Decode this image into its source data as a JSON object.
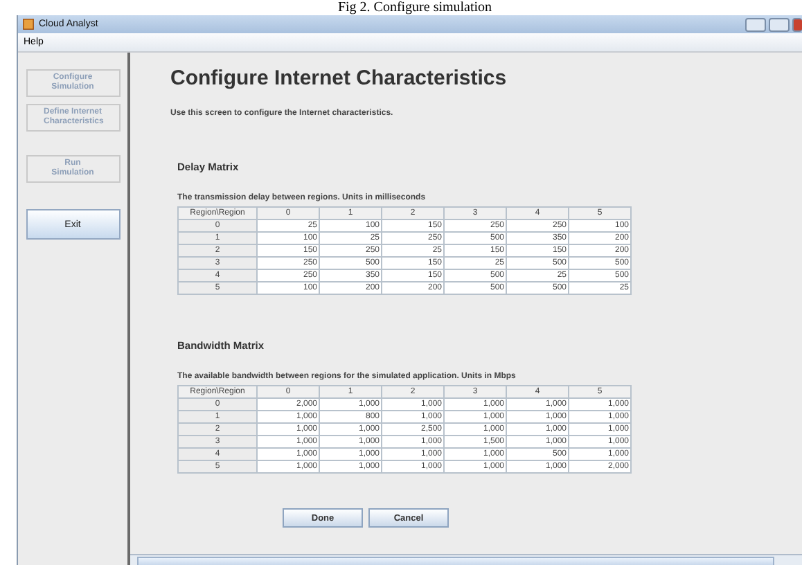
{
  "caption": "Fig 2. Configure simulation",
  "window": {
    "title": "Cloud Analyst"
  },
  "menu": [
    "Help"
  ],
  "sidebar": [
    {
      "label": "Configure Simulation",
      "disabled": true
    },
    {
      "label": "Define Internet Characteristics",
      "disabled": true
    },
    {
      "label": "Run Simulation",
      "disabled": true
    },
    {
      "label": "Exit",
      "disabled": false
    }
  ],
  "heading": "Configure Internet Characteristics",
  "description": "Use this screen to configure the Internet characteristics.",
  "matrices": [
    {
      "title": "Delay Matrix",
      "subtitle": "The transmission delay between regions. Units in milliseconds",
      "columns": [
        "Region\\Region",
        "0",
        "1",
        "2",
        "3",
        "4",
        "5"
      ],
      "rows": [
        [
          "0",
          "25",
          "100",
          "150",
          "250",
          "250",
          "100"
        ],
        [
          "1",
          "100",
          "25",
          "250",
          "500",
          "350",
          "200"
        ],
        [
          "2",
          "150",
          "250",
          "25",
          "150",
          "150",
          "200"
        ],
        [
          "3",
          "250",
          "500",
          "150",
          "25",
          "500",
          "500"
        ],
        [
          "4",
          "250",
          "350",
          "150",
          "500",
          "25",
          "500"
        ],
        [
          "5",
          "100",
          "200",
          "200",
          "500",
          "500",
          "25"
        ]
      ]
    },
    {
      "title": "Bandwidth Matrix",
      "subtitle": "The available bandwidth between regions for the simulated application. Units in Mbps",
      "columns": [
        "Region\\Region",
        "0",
        "1",
        "2",
        "3",
        "4",
        "5"
      ],
      "rows": [
        [
          "0",
          "2,000",
          "1,000",
          "1,000",
          "1,000",
          "1,000",
          "1,000"
        ],
        [
          "1",
          "1,000",
          "800",
          "1,000",
          "1,000",
          "1,000",
          "1,000"
        ],
        [
          "2",
          "1,000",
          "1,000",
          "2,500",
          "1,000",
          "1,000",
          "1,000"
        ],
        [
          "3",
          "1,000",
          "1,000",
          "1,000",
          "1,500",
          "1,000",
          "1,000"
        ],
        [
          "4",
          "1,000",
          "1,000",
          "1,000",
          "1,000",
          "500",
          "1,000"
        ],
        [
          "5",
          "1,000",
          "1,000",
          "1,000",
          "1,000",
          "1,000",
          "2,000"
        ]
      ]
    }
  ],
  "buttons": [
    "Done",
    "Cancel"
  ]
}
